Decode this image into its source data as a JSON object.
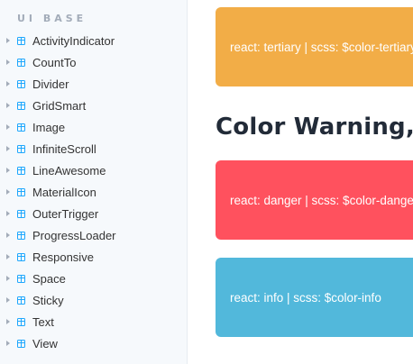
{
  "sidebar": {
    "section_title": "UI BASE",
    "items": [
      {
        "label": "ActivityIndicator"
      },
      {
        "label": "CountTo"
      },
      {
        "label": "Divider"
      },
      {
        "label": "GridSmart"
      },
      {
        "label": "Image"
      },
      {
        "label": "InfiniteScroll"
      },
      {
        "label": "LineAwesome"
      },
      {
        "label": "MaterialIcon"
      },
      {
        "label": "OuterTrigger"
      },
      {
        "label": "ProgressLoader"
      },
      {
        "label": "Responsive"
      },
      {
        "label": "Space"
      },
      {
        "label": "Sticky"
      },
      {
        "label": "Text"
      },
      {
        "label": "View"
      }
    ],
    "icon": "component-icon",
    "accent_color": "#1ea7fd"
  },
  "main": {
    "tertiary_card": {
      "text": "react: tertiary | scss: $color-tertiary",
      "color": "#f2ad47"
    },
    "heading": "Color Warning, Danger & Info",
    "danger_card": {
      "text": "react: danger | scss: $color-danger",
      "color": "#ff515e"
    },
    "info_card": {
      "text": "react: info | scss: $color-info",
      "color": "#52b8db"
    }
  }
}
